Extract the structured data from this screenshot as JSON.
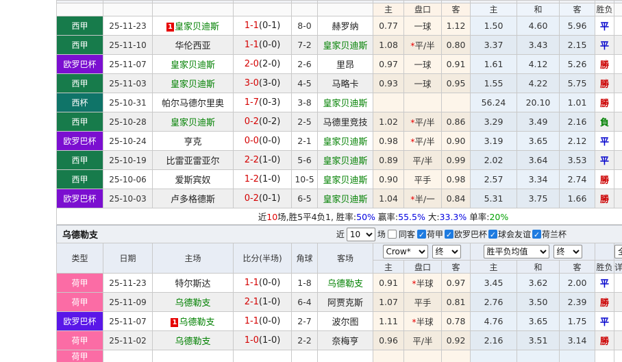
{
  "colors": {
    "laliga_green": "#177B4B",
    "europa_purple_t1": "#7B0FD0",
    "copa_teal": "#0F7468",
    "eredivisie_pink": "#FB6CA5",
    "europa_purple_t2": "#5A17E8",
    "win_red": "#CC0000",
    "draw_blue": "#0000CC",
    "lose_green": "#008000",
    "team_green": "#008000",
    "score_red": "#D40000",
    "badge_red": "#E60000",
    "checkbox_blue": "#1E7BE0"
  },
  "odds_header": {
    "asia_home": "主",
    "handicap": "盘口",
    "asia_away": "客",
    "euro_home": "主",
    "euro_draw": "和",
    "euro_away": "客",
    "result": "胜负",
    "cut_col": "详"
  },
  "table1": {
    "rows": [
      {
        "league": "西甲",
        "bg": "#177B4B",
        "date": "25-11-23",
        "badge": "1",
        "home": "皇家贝迪斯",
        "home_c": "#008000",
        "score": "1-1",
        "half": "(0-1)",
        "corner": "8-0",
        "away": "赫罗纳",
        "away_c": "#222222",
        "ah": "0.77",
        "star": "",
        "hcap": "一球",
        "aa": "1.12",
        "eh": "1.50",
        "ed": "4.60",
        "ea": "5.96",
        "res": "平",
        "res_c": "#0000CC"
      },
      {
        "league": "西甲",
        "bg": "#177B4B",
        "date": "25-11-10",
        "badge": "",
        "home": "华伦西亚",
        "home_c": "#222222",
        "score": "1-1",
        "half": "(0-0)",
        "corner": "7-2",
        "away": "皇家贝迪斯",
        "away_c": "#008000",
        "ah": "1.08",
        "star": "*",
        "hcap": "平/半",
        "aa": "0.80",
        "eh": "3.37",
        "ed": "3.43",
        "ea": "2.15",
        "res": "平",
        "res_c": "#0000CC"
      },
      {
        "league": "欧罗巴杯",
        "bg": "#7B0FD0",
        "date": "25-11-07",
        "badge": "",
        "home": "皇家贝迪斯",
        "home_c": "#008000",
        "score": "2-0",
        "half": "(2-0)",
        "corner": "2-6",
        "away": "里昂",
        "away_c": "#222222",
        "ah": "0.97",
        "star": "",
        "hcap": "一球",
        "aa": "0.91",
        "eh": "1.61",
        "ed": "4.12",
        "ea": "5.26",
        "res": "勝",
        "res_c": "#CC0000"
      },
      {
        "league": "西甲",
        "bg": "#177B4B",
        "date": "25-11-03",
        "badge": "",
        "home": "皇家贝迪斯",
        "home_c": "#008000",
        "score": "3-0",
        "half": "(3-0)",
        "corner": "4-5",
        "away": "马略卡",
        "away_c": "#222222",
        "ah": "0.93",
        "star": "",
        "hcap": "一球",
        "aa": "0.95",
        "eh": "1.55",
        "ed": "4.22",
        "ea": "5.75",
        "res": "勝",
        "res_c": "#CC0000"
      },
      {
        "league": "西杯",
        "bg": "#0F7468",
        "date": "25-10-31",
        "badge": "",
        "home": "帕尔马德尔里奥",
        "home_c": "#222222",
        "score": "1-7",
        "half": "(0-3)",
        "corner": "3-8",
        "away": "皇家贝迪斯",
        "away_c": "#008000",
        "ah": "",
        "star": "",
        "hcap": "",
        "aa": "",
        "eh": "56.24",
        "ed": "20.10",
        "ea": "1.01",
        "res": "勝",
        "res_c": "#CC0000"
      },
      {
        "league": "西甲",
        "bg": "#177B4B",
        "date": "25-10-28",
        "badge": "",
        "home": "皇家贝迪斯",
        "home_c": "#008000",
        "score": "0-2",
        "half": "(0-2)",
        "corner": "2-5",
        "away": "马德里竞技",
        "away_c": "#222222",
        "ah": "1.02",
        "star": "*",
        "hcap": "平/半",
        "aa": "0.86",
        "eh": "3.29",
        "ed": "3.49",
        "ea": "2.16",
        "res": "負",
        "res_c": "#008000"
      },
      {
        "league": "欧罗巴杯",
        "bg": "#7B0FD0",
        "date": "25-10-24",
        "badge": "",
        "home": "亨克",
        "home_c": "#222222",
        "score": "0-0",
        "half": "(0-0)",
        "corner": "2-1",
        "away": "皇家贝迪斯",
        "away_c": "#008000",
        "ah": "0.98",
        "star": "*",
        "hcap": "平/半",
        "aa": "0.90",
        "eh": "3.19",
        "ed": "3.65",
        "ea": "2.12",
        "res": "平",
        "res_c": "#0000CC"
      },
      {
        "league": "西甲",
        "bg": "#177B4B",
        "date": "25-10-19",
        "badge": "",
        "home": "比雷亚雷亚尔",
        "home_c": "#222222",
        "score": "2-2",
        "half": "(1-0)",
        "corner": "5-6",
        "away": "皇家贝迪斯",
        "away_c": "#008000",
        "ah": "0.89",
        "star": "",
        "hcap": "平/半",
        "aa": "0.99",
        "eh": "2.02",
        "ed": "3.64",
        "ea": "3.53",
        "res": "平",
        "res_c": "#0000CC"
      },
      {
        "league": "西甲",
        "bg": "#177B4B",
        "date": "25-10-06",
        "badge": "",
        "home": "爱斯宾奴",
        "home_c": "#222222",
        "score": "1-2",
        "half": "(1-0)",
        "corner": "10-5",
        "away": "皇家贝迪斯",
        "away_c": "#008000",
        "ah": "0.90",
        "star": "",
        "hcap": "平手",
        "aa": "0.98",
        "eh": "2.57",
        "ed": "3.34",
        "ea": "2.74",
        "res": "勝",
        "res_c": "#CC0000"
      },
      {
        "league": "欧罗巴杯",
        "bg": "#7B0FD0",
        "date": "25-10-03",
        "badge": "",
        "home": "卢多格德斯",
        "home_c": "#222222",
        "score": "0-2",
        "half": "(0-1)",
        "corner": "6-5",
        "away": "皇家贝迪斯",
        "away_c": "#008000",
        "ah": "1.04",
        "star": "*",
        "hcap": "半/一",
        "aa": "0.84",
        "eh": "5.31",
        "ed": "3.75",
        "ea": "1.66",
        "res": "勝",
        "res_c": "#CC0000"
      }
    ],
    "summary_parts": [
      {
        "t": "近",
        "c": "#222222"
      },
      {
        "t": "10",
        "c": "#E00000"
      },
      {
        "t": "场,胜5平4负1, 胜率:",
        "c": "#222222"
      },
      {
        "t": "50%",
        "c": "#0000E0"
      },
      {
        "t": " 赢率:",
        "c": "#222222"
      },
      {
        "t": "55.5%",
        "c": "#0000E0"
      },
      {
        "t": " 大:",
        "c": "#222222"
      },
      {
        "t": "33.3%",
        "c": "#0000E0"
      },
      {
        "t": " 单率:",
        "c": "#222222"
      },
      {
        "t": "20%",
        "c": "#00A000"
      }
    ]
  },
  "section2": {
    "title": "乌德勒支",
    "near_label": "近",
    "recent_value": "10",
    "games_label": "场",
    "same_away_label": "同客",
    "filters": [
      {
        "label": "荷甲",
        "checked": true
      },
      {
        "label": "欧罗巴杯",
        "checked": true
      },
      {
        "label": "球会友谊",
        "checked": true
      },
      {
        "label": "荷兰杯",
        "checked": true
      }
    ]
  },
  "table2": {
    "left_header": {
      "type": "类型",
      "date": "日期",
      "home": "主场",
      "score": "比分(半场)",
      "corner": "角球",
      "away": "客场"
    },
    "selects": {
      "bookmaker": "Crow*",
      "final1": "终",
      "avg": "胜平负均值",
      "final2": "终",
      "cut": "全"
    },
    "rows": [
      {
        "league": "荷甲",
        "bg": "#FB6CA5",
        "date": "25-11-23",
        "badge": "",
        "home": "特尔斯达",
        "home_c": "#222222",
        "score": "1-1",
        "half": "(0-0)",
        "corner": "1-8",
        "away": "乌德勒支",
        "away_c": "#008000",
        "ah": "0.91",
        "star": "*",
        "hcap": "半球",
        "aa": "0.97",
        "eh": "3.45",
        "ed": "3.62",
        "ea": "2.00",
        "res": "平",
        "res_c": "#0000CC"
      },
      {
        "league": "荷甲",
        "bg": "#FB6CA5",
        "date": "25-11-09",
        "badge": "",
        "home": "乌德勒支",
        "home_c": "#008000",
        "score": "2-1",
        "half": "(1-0)",
        "corner": "6-4",
        "away": "阿贾克斯",
        "away_c": "#222222",
        "ah": "1.07",
        "star": "",
        "hcap": "平手",
        "aa": "0.81",
        "eh": "2.76",
        "ed": "3.50",
        "ea": "2.39",
        "res": "勝",
        "res_c": "#CC0000"
      },
      {
        "league": "欧罗巴杯",
        "bg": "#5A17E8",
        "date": "25-11-07",
        "badge": "1",
        "home": "乌德勒支",
        "home_c": "#008000",
        "score": "1-1",
        "half": "(0-0)",
        "corner": "2-7",
        "away": "波尔图",
        "away_c": "#222222",
        "ah": "1.11",
        "star": "*",
        "hcap": "半球",
        "aa": "0.78",
        "eh": "4.76",
        "ed": "3.65",
        "ea": "1.75",
        "res": "平",
        "res_c": "#0000CC"
      },
      {
        "league": "荷甲",
        "bg": "#FB6CA5",
        "date": "25-11-02",
        "badge": "",
        "home": "乌德勒支",
        "home_c": "#008000",
        "score": "1-0",
        "half": "(1-0)",
        "corner": "2-2",
        "away": "奈梅亨",
        "away_c": "#222222",
        "ah": "0.96",
        "star": "",
        "hcap": "平/半",
        "aa": "0.92",
        "eh": "2.16",
        "ed": "3.51",
        "ea": "3.14",
        "res": "勝",
        "res_c": "#CC0000"
      }
    ],
    "partial_row": {
      "league": "荷甲",
      "bg": "#FB6CA5",
      "date": "",
      "badge": "",
      "home": "",
      "home_c": "#222222",
      "score": "",
      "half": "",
      "corner": "",
      "away": "",
      "away_c": "#222222",
      "ah": "",
      "star": "",
      "hcap": "",
      "aa": "",
      "eh": "",
      "ed": "",
      "ea": "",
      "res": "",
      "res_c": "#222222"
    }
  }
}
